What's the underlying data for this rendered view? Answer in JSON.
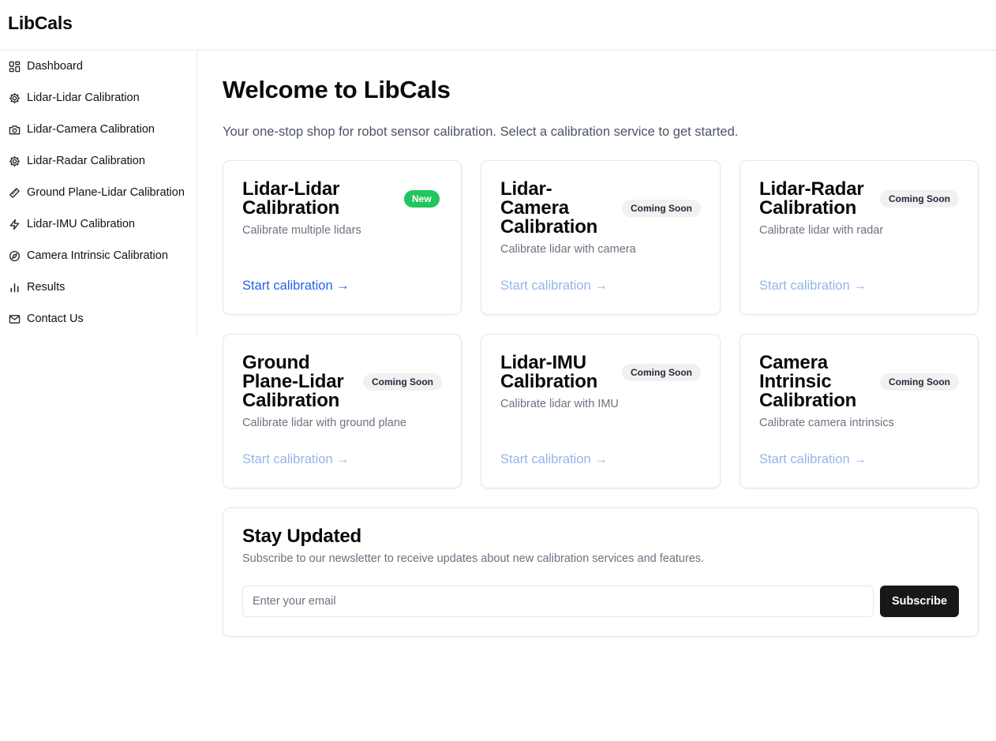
{
  "app": {
    "brand": "LibCals"
  },
  "sidebar": {
    "items": [
      {
        "label": "Dashboard",
        "icon": "dashboard-grid-icon"
      },
      {
        "label": "Lidar-Lidar Calibration",
        "icon": "gear-icon"
      },
      {
        "label": "Lidar-Camera Calibration",
        "icon": "camera-icon"
      },
      {
        "label": "Lidar-Radar Calibration",
        "icon": "gear-icon"
      },
      {
        "label": "Ground Plane-Lidar Calibration",
        "icon": "ruler-icon"
      },
      {
        "label": "Lidar-IMU Calibration",
        "icon": "lightning-icon"
      },
      {
        "label": "Camera Intrinsic Calibration",
        "icon": "compass-icon"
      },
      {
        "label": "Results",
        "icon": "bar-chart-icon"
      },
      {
        "label": "Contact Us",
        "icon": "mail-icon"
      }
    ]
  },
  "main": {
    "title": "Welcome to LibCals",
    "subtitle": "Your one-stop shop for robot sensor calibration. Select a calibration service to get started.",
    "cards": [
      {
        "title_lines": [
          "Lidar-Lidar",
          "Calibration"
        ],
        "badge": "New",
        "description": "Calibrate multiple lidars",
        "link": "Start calibration →"
      },
      {
        "title_lines": [
          "Lidar-",
          "Camera",
          "Calibration"
        ],
        "badge": "Coming Soon",
        "description": "Calibrate lidar with camera",
        "link": "Start calibration →"
      },
      {
        "title_lines": [
          "Lidar-Radar",
          "Calibration"
        ],
        "badge": "Coming Soon",
        "description": "Calibrate lidar with radar",
        "link": "Start calibration →"
      },
      {
        "title_lines": [
          "Ground",
          "Plane-Lidar",
          "Calibration"
        ],
        "badge": "Coming Soon",
        "description": "Calibrate lidar with ground plane",
        "link": "Start calibration →"
      },
      {
        "title_lines": [
          "Lidar-IMU",
          "Calibration"
        ],
        "badge": "Coming Soon",
        "description": "Calibrate lidar with IMU",
        "link": "Start calibration →"
      },
      {
        "title_lines": [
          "Camera",
          "Intrinsic",
          "Calibration"
        ],
        "badge": "Coming Soon",
        "description": "Calibrate camera intrinsics",
        "link": "Start calibration →"
      }
    ]
  },
  "newsletter": {
    "title": "Stay Updated",
    "description": "Subscribe to our newsletter to receive updates about new calibration services and features.",
    "email_placeholder": "Enter your email",
    "email_value": "",
    "button_label": "Subscribe"
  },
  "colors": {
    "new_badge": "#22c55e",
    "link_active": "#2563eb",
    "link_inactive": "#93b6ea",
    "button_bg": "#18181b"
  }
}
